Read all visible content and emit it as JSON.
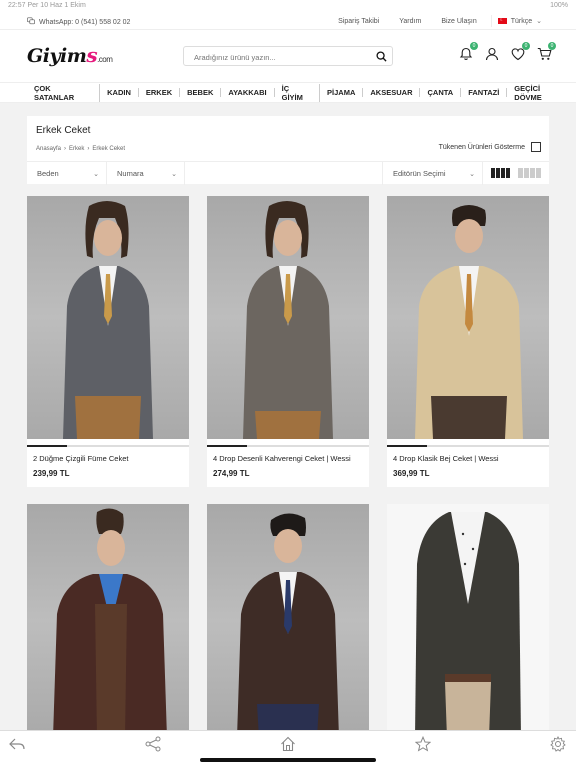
{
  "status_bar": {
    "left": "22:57 Per 10 Haz 1 Ekim",
    "right": "100%"
  },
  "topbar": {
    "whatsapp": "WhatsApp: 0 (541) 558 02 02",
    "links": [
      "Sipariş Takibi",
      "Yardım",
      "Bize Ulaşın"
    ],
    "language": "Türkçe"
  },
  "header": {
    "logo_main": "Giyim",
    "logo_s": "s",
    "logo_suffix": ".com",
    "search_placeholder": "Aradığınız ürünü yazın...",
    "badges": {
      "notifications": "0",
      "wishlist": "0",
      "cart": "0"
    },
    "colors": {
      "brand_pink": "#e6197d",
      "badge_green": "#3cb371"
    }
  },
  "nav": [
    "ÇOK SATANLAR",
    "KADIN",
    "ERKEK",
    "BEBEK",
    "AYAKKABI",
    "İÇ GİYİM",
    "PİJAMA",
    "AKSESUAR",
    "ÇANTA",
    "FANTAZİ",
    "GEÇİCİ DÖVME"
  ],
  "page": {
    "title": "Erkek Ceket",
    "breadcrumb": [
      "Anasayfa",
      "Erkek",
      "Erkek Ceket"
    ],
    "hide_out_of_stock": "Tükenen Ürünleri Gösterme"
  },
  "filters": {
    "size": "Beden",
    "number": "Numara",
    "sort": "Editörün Seçimi"
  },
  "products": [
    {
      "name": "2 Düğme Çizgili Füme Ceket",
      "price": "239,99 TL",
      "jacket": "#5e6066",
      "shirt": "#f4f4f4",
      "tie": "#c99a4a",
      "pants": "#a0713f"
    },
    {
      "name": "4 Drop Desenli Kahverengi Ceket | Wessi",
      "price": "274,99 TL",
      "jacket": "#6c6660",
      "shirt": "#f4f4f4",
      "tie": "#c99a4a",
      "pants": "#a0713f"
    },
    {
      "name": "4 Drop Klasik Bej Ceket | Wessi",
      "price": "369,99 TL",
      "jacket": "#d8c39a",
      "shirt": "#f4f4f4",
      "tie": "#c4893f",
      "pants": "#4a3a30"
    },
    {
      "name": "",
      "price": "",
      "jacket": "#4a2a24",
      "shirt": "#3b78c9",
      "tie": "#5a3a2a",
      "pants": "#444"
    },
    {
      "name": "",
      "price": "",
      "jacket": "#3e2c26",
      "shirt": "#f4f4f4",
      "tie": "#2a3a6a",
      "pants": "#2a3050"
    },
    {
      "name": "",
      "price": "",
      "jacket": "#3b3a35",
      "shirt": "#f4f4f4",
      "tie": "",
      "pants": "#c8b49a"
    }
  ]
}
